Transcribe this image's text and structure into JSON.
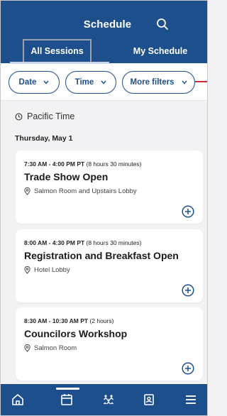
{
  "header": {
    "title": "Schedule",
    "search_icon": "search-icon",
    "tabs": [
      {
        "label": "All Sessions",
        "active": true
      },
      {
        "label": "My Schedule",
        "active": false
      }
    ]
  },
  "filters": {
    "chips": [
      {
        "label": "Date"
      },
      {
        "label": "Time"
      },
      {
        "label": "More filters"
      }
    ]
  },
  "timezone": {
    "label": "Pacific Time",
    "icon": "clock-icon"
  },
  "day_heading": "Thursday, May 1",
  "sessions": [
    {
      "time_bold": "7:30 AM - 4:00 PM PT",
      "duration": " (8 hours 30 minutes)",
      "title": "Trade Show Open",
      "location": "Salmon Room and Upstairs Lobby"
    },
    {
      "time_bold": "8:00 AM - 4:30 PM PT",
      "duration": " (8 hours 30 minutes)",
      "title": "Registration and Breakfast Open",
      "location": "Hotel Lobby"
    },
    {
      "time_bold": "8:30 AM - 10:30 AM PT",
      "duration": " (2 hours)",
      "title": "Councilors Workshop",
      "location": "Salmon Room"
    }
  ],
  "bottom_nav": {
    "items": [
      {
        "icon": "home-icon"
      },
      {
        "icon": "calendar-icon",
        "active": true
      },
      {
        "icon": "people-icon"
      },
      {
        "icon": "contact-book-icon"
      },
      {
        "icon": "menu-icon"
      }
    ]
  },
  "colors": {
    "brand": "#1c4f8c",
    "background": "#f2f2f4",
    "accent_red": "#d9232e"
  }
}
